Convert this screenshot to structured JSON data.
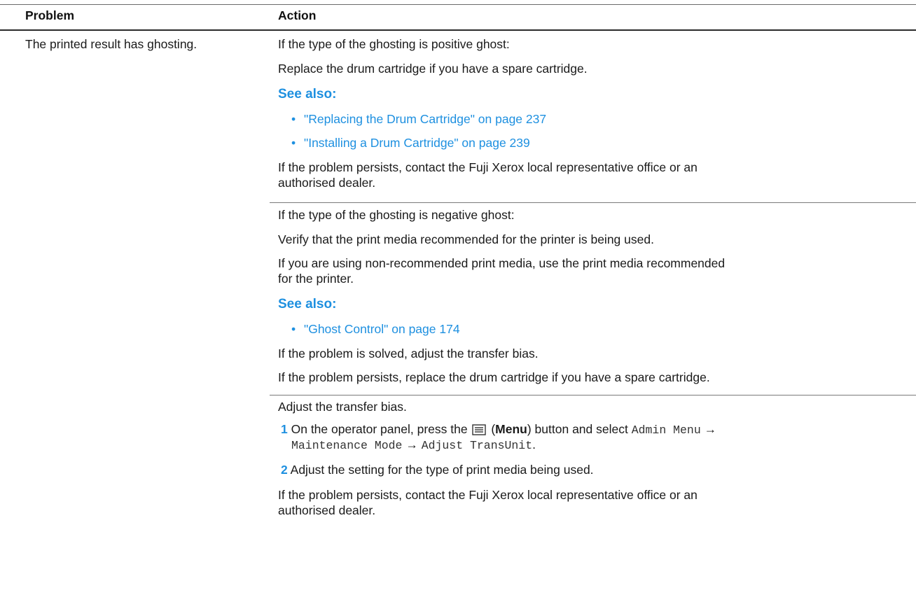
{
  "table": {
    "headers": {
      "problem": "Problem",
      "action": "Action"
    },
    "problem": "The printed result has ghosting.",
    "sections": [
      {
        "intro": "If the type of the ghosting is positive ghost:",
        "p1": "Replace the drum cartridge if you have a spare cartridge.",
        "see_also": "See also:",
        "links": [
          "\"Replacing the Drum Cartridge\" on page 237",
          "\"Installing a Drum Cartridge\" on page 239"
        ],
        "p2_line1": "If the problem persists, contact the Fuji Xerox local representative office or an",
        "p2_line2": "authorised dealer."
      },
      {
        "intro": "If the type of the ghosting is negative ghost:",
        "p1": "Verify that the print media recommended for the printer is being used.",
        "p2_line1": "If you are using non-recommended print media, use the print media recommended",
        "p2_line2": "for the printer.",
        "see_also": "See also:",
        "links": [
          "\"Ghost Control\" on page 174"
        ],
        "p3": "If the problem is solved, adjust the transfer bias.",
        "p4": "If the problem persists, replace the drum cartridge if you have a spare cartridge."
      },
      {
        "intro": "Adjust the transfer bias.",
        "steps": [
          {
            "num": "1",
            "pre": "On the operator panel, press the",
            "menu_open": "(",
            "menu_word": "Menu",
            "menu_close": ") button and select",
            "path1": "Admin Menu",
            "arrow": "→",
            "path2": "Maintenance Mode",
            "path3": "Adjust TransUnit",
            "end": "."
          },
          {
            "num": "2",
            "text": "Adjust the setting for the type of print media being used."
          }
        ],
        "p_line1": "If the problem persists, contact the Fuji Xerox local representative office or an",
        "p_line2": "authorised dealer."
      }
    ],
    "icons": {
      "bullet": "•",
      "menu_button": "menu-list-icon"
    },
    "colors": {
      "link": "#1e90e0",
      "text": "#1a1a1a"
    }
  }
}
